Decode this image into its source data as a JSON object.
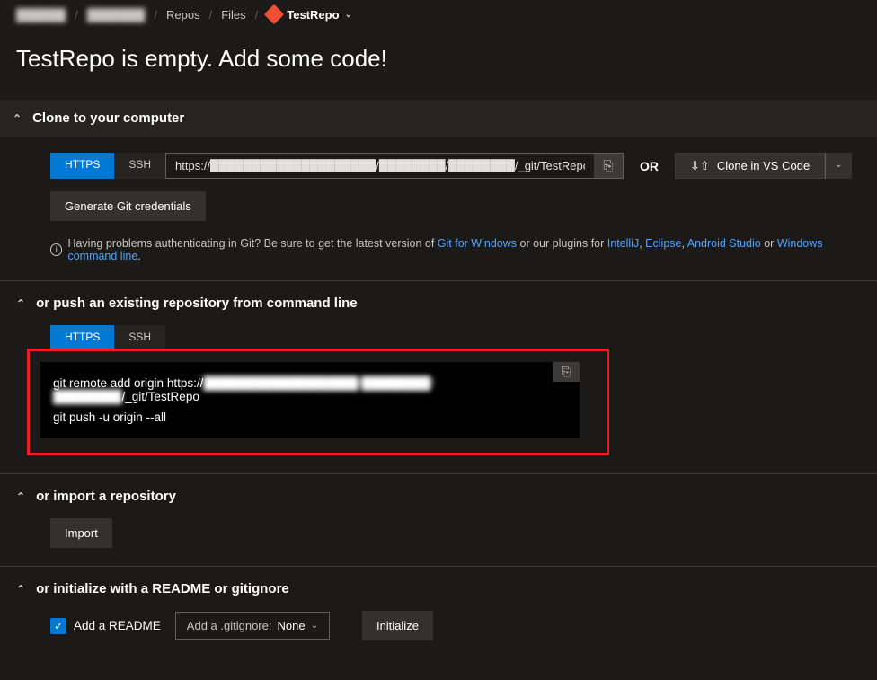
{
  "breadcrumb": {
    "org": "██████",
    "project": "███████",
    "repos": "Repos",
    "files": "Files",
    "repo_name": "TestRepo"
  },
  "page_title": "TestRepo is empty. Add some code!",
  "sections": {
    "clone": {
      "title": "Clone to your computer",
      "tab_https": "HTTPS",
      "tab_ssh": "SSH",
      "url": "https://████████████████████/████████/████████/_git/TestRepo",
      "or": "OR",
      "vscode_label": "Clone in VS Code",
      "gen_creds": "Generate Git credentials",
      "help_prefix": "Having problems authenticating in Git? Be sure to get the latest version of ",
      "link_gitwin": "Git for Windows",
      "help_mid": " or our plugins for ",
      "link_intellij": "IntelliJ",
      "link_eclipse": "Eclipse",
      "link_android": "Android Studio",
      "help_or": " or ",
      "link_wcl": "Windows command line",
      "help_end": "."
    },
    "push": {
      "title": "or push an existing repository from command line",
      "tab_https": "HTTPS",
      "tab_ssh": "SSH",
      "cmd1_prefix": "git remote add origin https://",
      "cmd1_blur": "██████████████████/████████/████████",
      "cmd1_suffix": "/_git/TestRepo",
      "cmd2": "git push -u origin --all"
    },
    "import": {
      "title": "or import a repository",
      "btn": "Import"
    },
    "init": {
      "title": "or initialize with a README or gitignore",
      "readme_label": "Add a README",
      "gitignore_label": "Add a .gitignore:",
      "gitignore_value": "None",
      "initialize_btn": "Initialize"
    }
  }
}
